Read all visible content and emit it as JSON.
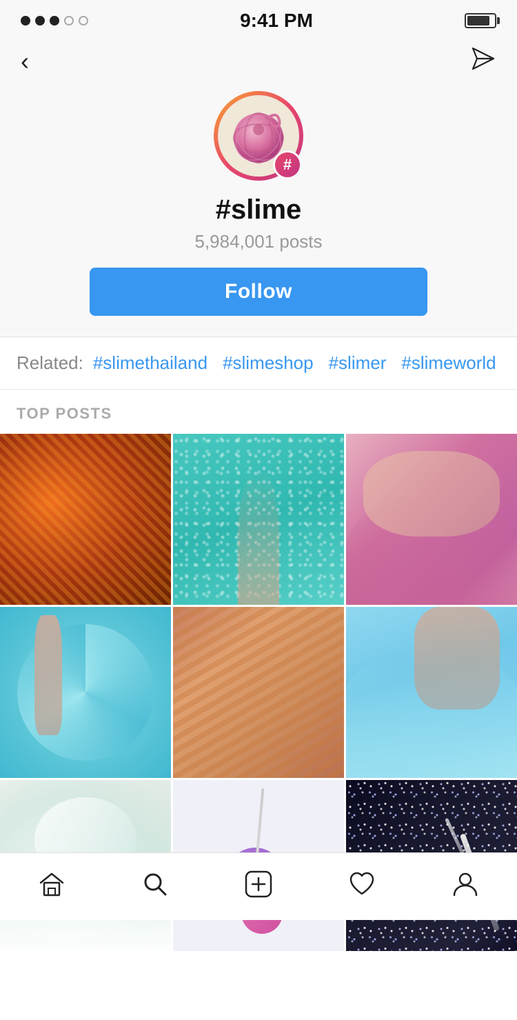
{
  "statusBar": {
    "time": "9:41 PM",
    "dots": [
      "filled",
      "filled",
      "filled",
      "empty",
      "empty"
    ]
  },
  "nav": {
    "backLabel": "‹",
    "sendIcon": "send"
  },
  "profile": {
    "hashtag": "#slime",
    "postCount": "5,984,001 posts",
    "followLabel": "Follow",
    "badgeSymbol": "#"
  },
  "related": {
    "label": "Related:",
    "tags": [
      "#slimethailand",
      "#slimeshop",
      "#slimer",
      "#slimeworld"
    ]
  },
  "topPosts": {
    "sectionLabel": "TOP POSTS"
  },
  "bottomNav": {
    "items": [
      "home",
      "search",
      "add",
      "heart",
      "profile"
    ]
  }
}
